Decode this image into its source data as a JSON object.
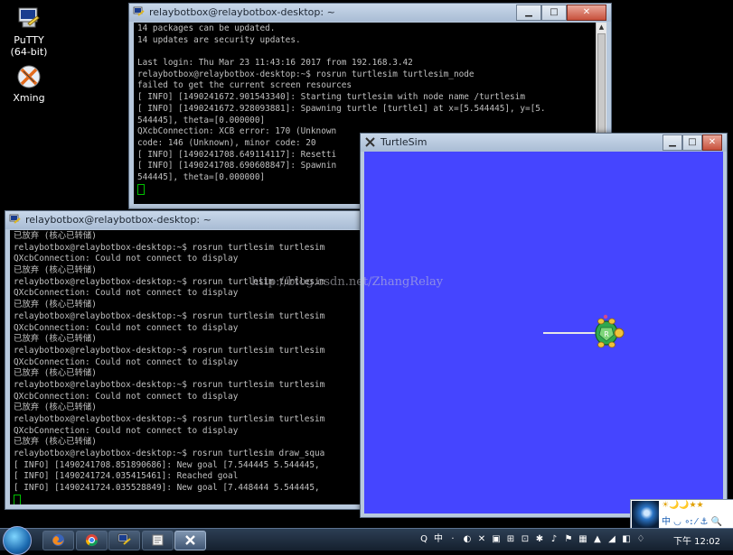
{
  "desktop": {
    "icons": [
      {
        "label": "PuTTY\n(64-bit)",
        "icon": "putty-icon"
      },
      {
        "label": "Xming",
        "icon": "xming-icon"
      }
    ]
  },
  "win1": {
    "title": "relaybotbox@relaybotbox-desktop: ~",
    "controls": {
      "minimize": "▁",
      "maximize": "□",
      "close": "✕"
    },
    "lines": [
      "14 packages can be updated.",
      "14 updates are security updates.",
      "",
      "Last login: Thu Mar 23 11:43:16 2017 from 192.168.3.42",
      "relaybotbox@relaybotbox-desktop:~$ rosrun turtlesim turtlesim_node",
      "failed to get the current screen resources",
      "[ INFO] [1490241672.901543340]: Starting turtlesim with node name /turtlesim",
      "[ INFO] [1490241672.928093881]: Spawning turtle [turtle1] at x=[5.544445], y=[5.",
      "544445], theta=[0.000000]",
      "QXcbConnection: XCB error: 170 (Unknown",
      "code: 146 (Unknown), minor code: 20",
      "[ INFO] [1490241708.649114117]: Resetti",
      "[ INFO] [1490241708.690608847]: Spawnin",
      "544445], theta=[0.000000]"
    ]
  },
  "win2": {
    "title": "relaybotbox@relaybotbox-desktop: ~",
    "lines": [
      "已放弃 (核心已转储)",
      "relaybotbox@relaybotbox-desktop:~$ rosrun turtlesim turtlesim",
      "QXcbConnection: Could not connect to display",
      "已放弃 (核心已转储)",
      "relaybotbox@relaybotbox-desktop:~$ rosrun turtlesim turtlesim",
      "QXcbConnection: Could not connect to display",
      "已放弃 (核心已转储)",
      "relaybotbox@relaybotbox-desktop:~$ rosrun turtlesim turtlesim",
      "QXcbConnection: Could not connect to display",
      "已放弃 (核心已转储)",
      "relaybotbox@relaybotbox-desktop:~$ rosrun turtlesim turtlesim",
      "QXcbConnection: Could not connect to display",
      "已放弃 (核心已转储)",
      "relaybotbox@relaybotbox-desktop:~$ rosrun turtlesim turtlesim",
      "QXcbConnection: Could not connect to display",
      "已放弃 (核心已转储)",
      "relaybotbox@relaybotbox-desktop:~$ rosrun turtlesim turtlesim",
      "QXcbConnection: Could not connect to display",
      "已放弃 (核心已转储)",
      "relaybotbox@relaybotbox-desktop:~$ rosrun turtlesim draw_squa",
      "[ INFO] [1490241708.851890686]: New goal [7.544445 5.544445,",
      "[ INFO] [1490241724.035415461]: Reached goal",
      "[ INFO] [1490241724.035528849]: New goal [7.448444 5.544445,"
    ]
  },
  "turtlesim": {
    "title": "TurtleSim",
    "background": "#4545ff",
    "trail_color": "#e6e6e6",
    "turtle_shell": "#2fa84f"
  },
  "watermark": "http://blog.csdn.net/ZhangRelay",
  "taskbar": {
    "apps": [
      "start-orb",
      "firefox-icon",
      "chrome-icon",
      "putty-icon",
      "files-icon",
      "xming-icon"
    ],
    "clock": "下午 12:02",
    "tray_glyphs": [
      "Q",
      "中",
      "·",
      "◐",
      "✕",
      "▣",
      "⊞",
      "⊡",
      "✱",
      "♪",
      "⚑",
      "▦",
      "▲",
      "◢",
      "◧",
      "♢"
    ]
  },
  "ime": {
    "top_text": "☀🌙🌙★★",
    "row_text": "中 ◡ ∘ꓽ ⁄ ⚓ 🔍"
  }
}
